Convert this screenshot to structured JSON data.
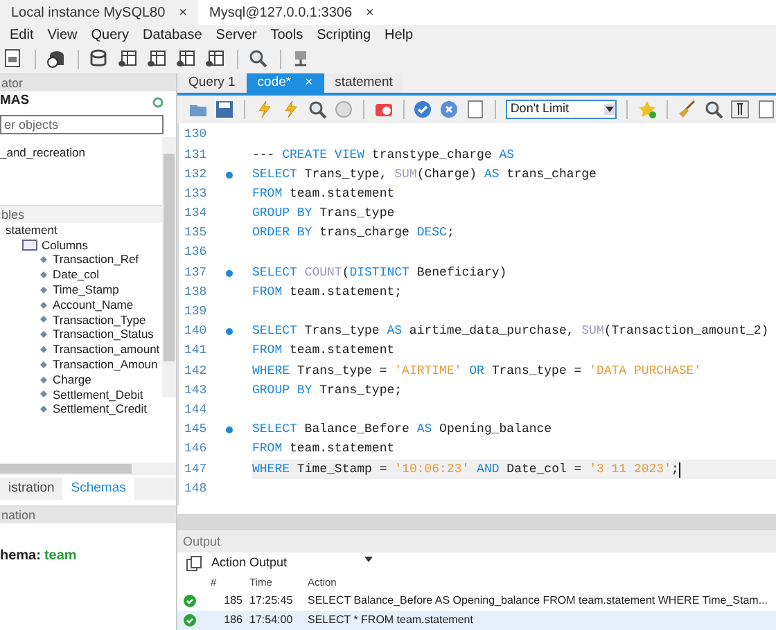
{
  "app_tabs": [
    {
      "label": "Local instance MySQL80",
      "close": "×",
      "selected": true
    },
    {
      "label": "Mysql@127.0.0.1:3306",
      "close": "×",
      "selected": false
    }
  ],
  "menu": [
    "Edit",
    "View",
    "Query",
    "Database",
    "Server",
    "Tools",
    "Scripting",
    "Help"
  ],
  "navigator": {
    "title": "ator",
    "schemas_title": "MAS",
    "filter": {
      "placeholder": "er objects"
    },
    "tree_top": [
      "_and_recreation"
    ],
    "tables_label": "bles",
    "tree": [
      {
        "label": "statement",
        "children": [
          {
            "label": "Columns",
            "children": [
              {
                "label": "Transaction_Ref"
              },
              {
                "label": "Date_col"
              },
              {
                "label": "Time_Stamp"
              },
              {
                "label": "Account_Name"
              },
              {
                "label": "Transaction_Type"
              },
              {
                "label": "Transaction_Status"
              },
              {
                "label": "Transaction_amount"
              },
              {
                "label": "Transaction_Amoun"
              },
              {
                "label": "Charge"
              },
              {
                "label": "Settlement_Debit"
              },
              {
                "label": "Settlement_Credit"
              }
            ]
          }
        ]
      }
    ]
  },
  "nav_tabs": [
    {
      "label": "istration",
      "selected": false
    },
    {
      "label": "Schemas",
      "selected": true
    }
  ],
  "information": {
    "title": "nation",
    "schema_label": "hema:",
    "schema_value": "team"
  },
  "editor_tabs": [
    {
      "label": "Query 1",
      "selected": false
    },
    {
      "label": "code*",
      "selected": true,
      "close": "×"
    },
    {
      "label": "statement",
      "selected": false
    }
  ],
  "limit_select": {
    "value": "Don't Limit"
  },
  "code": [
    {
      "number": "130",
      "marker": false,
      "current": false
    },
    {
      "number": "131",
      "marker": false,
      "current": false,
      "tokens": [
        {
          "kind": "id",
          "t": "--- "
        },
        {
          "kind": "kw",
          "t": "CREATE VIEW"
        },
        {
          "kind": "id",
          "t": " transtype_charge "
        },
        {
          "kind": "kw",
          "t": "AS"
        }
      ]
    },
    {
      "number": "132",
      "marker": true,
      "current": false,
      "tokens": [
        {
          "kind": "kw",
          "t": "SELECT"
        },
        {
          "kind": "id",
          "t": " Trans_type, "
        },
        {
          "kind": "fn",
          "t": "SUM"
        },
        {
          "kind": "id",
          "t": "(Charge) "
        },
        {
          "kind": "kw",
          "t": "AS"
        },
        {
          "kind": "id",
          "t": " trans_charge"
        }
      ]
    },
    {
      "number": "133",
      "marker": false,
      "current": false,
      "tokens": [
        {
          "kind": "kw",
          "t": "FROM"
        },
        {
          "kind": "id",
          "t": " team.statement"
        }
      ]
    },
    {
      "number": "134",
      "marker": false,
      "current": false,
      "tokens": [
        {
          "kind": "kw",
          "t": "GROUP BY"
        },
        {
          "kind": "id",
          "t": " Trans_type"
        }
      ]
    },
    {
      "number": "135",
      "marker": false,
      "current": false,
      "tokens": [
        {
          "kind": "kw",
          "t": "ORDER BY"
        },
        {
          "kind": "id",
          "t": " trans_charge "
        },
        {
          "kind": "kw",
          "t": "DESC"
        },
        {
          "kind": "id",
          "t": ";"
        }
      ]
    },
    {
      "number": "136",
      "marker": false,
      "current": false
    },
    {
      "number": "137",
      "marker": true,
      "current": false,
      "tokens": [
        {
          "kind": "kw",
          "t": "SELECT"
        },
        {
          "kind": "fn",
          "t": " COUNT"
        },
        {
          "kind": "id",
          "t": "("
        },
        {
          "kind": "kw",
          "t": "DISTINCT"
        },
        {
          "kind": "id",
          "t": " Beneficiary)"
        }
      ]
    },
    {
      "number": "138",
      "marker": false,
      "current": false,
      "tokens": [
        {
          "kind": "kw",
          "t": "FROM"
        },
        {
          "kind": "id",
          "t": " team.statement;"
        }
      ]
    },
    {
      "number": "139",
      "marker": false,
      "current": false
    },
    {
      "number": "140",
      "marker": true,
      "current": false,
      "tokens": [
        {
          "kind": "kw",
          "t": "SELECT"
        },
        {
          "kind": "id",
          "t": " Trans_type "
        },
        {
          "kind": "kw",
          "t": "AS"
        },
        {
          "kind": "id",
          "t": " airtime_data_purchase, "
        },
        {
          "kind": "fn",
          "t": "SUM"
        },
        {
          "kind": "id",
          "t": "(Transaction_amount_2)"
        }
      ]
    },
    {
      "number": "141",
      "marker": false,
      "current": false,
      "tokens": [
        {
          "kind": "kw",
          "t": "FROM"
        },
        {
          "kind": "id",
          "t": " team.statement"
        }
      ]
    },
    {
      "number": "142",
      "marker": false,
      "current": false,
      "tokens": [
        {
          "kind": "kw",
          "t": "WHERE"
        },
        {
          "kind": "id",
          "t": " Trans_type = "
        },
        {
          "kind": "str",
          "t": "'AIRTIME'"
        },
        {
          "kind": "kw",
          "t": " OR"
        },
        {
          "kind": "id",
          "t": " Trans_type = "
        },
        {
          "kind": "str",
          "t": "'DATA PURCHASE'"
        }
      ]
    },
    {
      "number": "143",
      "marker": false,
      "current": false,
      "tokens": [
        {
          "kind": "kw",
          "t": "GROUP BY"
        },
        {
          "kind": "id",
          "t": " Trans_type;"
        }
      ]
    },
    {
      "number": "144",
      "marker": false,
      "current": false
    },
    {
      "number": "145",
      "marker": true,
      "current": false,
      "tokens": [
        {
          "kind": "kw",
          "t": "SELECT"
        },
        {
          "kind": "id",
          "t": " Balance_Before "
        },
        {
          "kind": "kw",
          "t": "AS"
        },
        {
          "kind": "id",
          "t": " Opening_balance"
        }
      ]
    },
    {
      "number": "146",
      "marker": false,
      "current": false,
      "tokens": [
        {
          "kind": "kw",
          "t": "FROM"
        },
        {
          "kind": "id",
          "t": " team.statement"
        }
      ]
    },
    {
      "number": "147",
      "marker": false,
      "current": true,
      "tokens": [
        {
          "kind": "kw",
          "t": "WHERE"
        },
        {
          "kind": "id",
          "t": " Time_Stamp = "
        },
        {
          "kind": "str",
          "t": "'10:06:23'"
        },
        {
          "kind": "kw",
          "t": " AND"
        },
        {
          "kind": "id",
          "t": " Date_col = "
        },
        {
          "kind": "str",
          "t": "'3 11 2023'"
        },
        {
          "kind": "id",
          "t": ";"
        }
      ]
    },
    {
      "number": "148",
      "marker": false,
      "current": false
    }
  ],
  "output": {
    "title": "Output",
    "mode": "Action Output",
    "columns": [
      "#",
      "Time",
      "Action"
    ],
    "rows": [
      {
        "success": true,
        "number": "185",
        "time": "17:25:45",
        "action": "SELECT Balance_Before AS Opening_balance FROM team.statement WHERE Time_Stam...",
        "selected": false
      },
      {
        "success": true,
        "number": "186",
        "time": "17:54:00",
        "action": "SELECT * FROM team.statement",
        "selected": true
      }
    ]
  }
}
